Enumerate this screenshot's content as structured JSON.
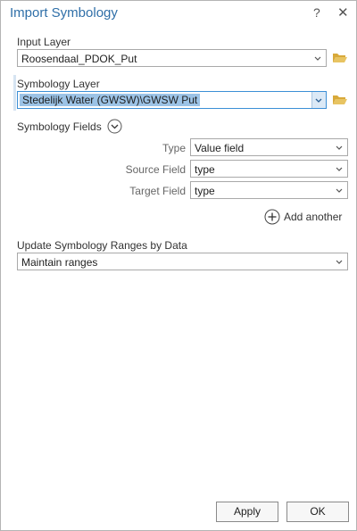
{
  "window": {
    "title": "Import Symbology",
    "help_glyph": "?",
    "close_glyph": "✕"
  },
  "input_layer": {
    "label": "Input Layer",
    "value": "Roosendaal_PDOK_Put"
  },
  "symbology_layer": {
    "label": "Symbology Layer",
    "value": "Stedelijk Water (GWSW)\\GWSW Put"
  },
  "symbology_fields": {
    "label": "Symbology Fields",
    "rows": [
      {
        "label": "Type",
        "value": "Value field"
      },
      {
        "label": "Source Field",
        "value": "type"
      },
      {
        "label": "Target Field",
        "value": "type"
      }
    ],
    "add_another": "Add another"
  },
  "update_ranges": {
    "label": "Update Symbology Ranges by Data",
    "value": "Maintain ranges"
  },
  "buttons": {
    "apply": "Apply",
    "ok": "OK"
  },
  "icons": {
    "folder": "folder-open-icon",
    "dropdown": "chevron-down-icon",
    "expand": "chevron-circle-icon",
    "add": "plus-circle-icon"
  },
  "colors": {
    "title": "#2f6fa8",
    "selection": "#9cc3e6",
    "folder": "#e2b84a"
  }
}
